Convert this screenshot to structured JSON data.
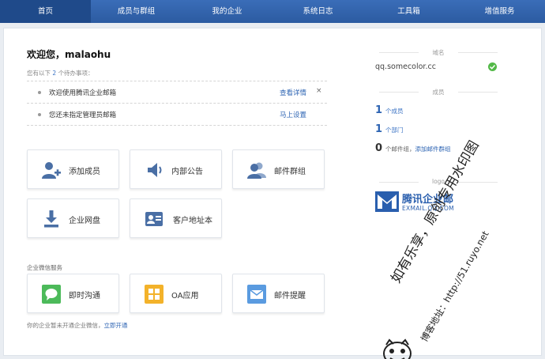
{
  "nav": [
    {
      "label": "首页",
      "active": true
    },
    {
      "label": "成员与群组"
    },
    {
      "label": "我的企业"
    },
    {
      "label": "系统日志"
    },
    {
      "label": "工具箱"
    },
    {
      "label": "增值服务"
    }
  ],
  "welcome": "欢迎您，malaohu",
  "todo_hint": {
    "prefix": "您有以下",
    "count": "2",
    "suffix": "个待办事项："
  },
  "todos": [
    {
      "text": "欢迎使用腾讯企业邮箱",
      "link": "查看详情",
      "close": "×"
    },
    {
      "text": "您还未指定管理员邮箱",
      "link": "马上设置"
    }
  ],
  "tiles": {
    "add_member": "添加成员",
    "notice": "内部公告",
    "mail_group": "邮件群组",
    "netdisk": "企业网盘",
    "addressbook": "客户地址本",
    "im": "即时沟通",
    "oa": "OA应用",
    "mail_remind": "邮件提醒"
  },
  "wechat": {
    "title": "企业微信服务",
    "note_prefix": "你的企业暂未开通企业微信，",
    "note_link": "立即开通"
  },
  "side": {
    "domain_head": "域名",
    "domain": "qq.somecolor.cc",
    "member_head": "成员",
    "members": {
      "count": "1",
      "unit": "个成员"
    },
    "departments": {
      "count": "1",
      "unit": "个部门"
    },
    "mailgroups": {
      "count": "0",
      "unit": "个邮件组，",
      "link": "添加邮件群组"
    },
    "logo_head": "logo",
    "logo_text": "腾讯企业邮",
    "logo_sub": "EXMAIL.QQ.COM"
  },
  "watermark": {
    "line1": "如有乐享，原创专用水印图",
    "line2": "博客地址：http://51.ruyo.net"
  },
  "colors": {
    "nav": "#2c5ba1",
    "link": "#2d64b3",
    "ok": "#53b948",
    "tile_icon": "#4a6fa5"
  }
}
